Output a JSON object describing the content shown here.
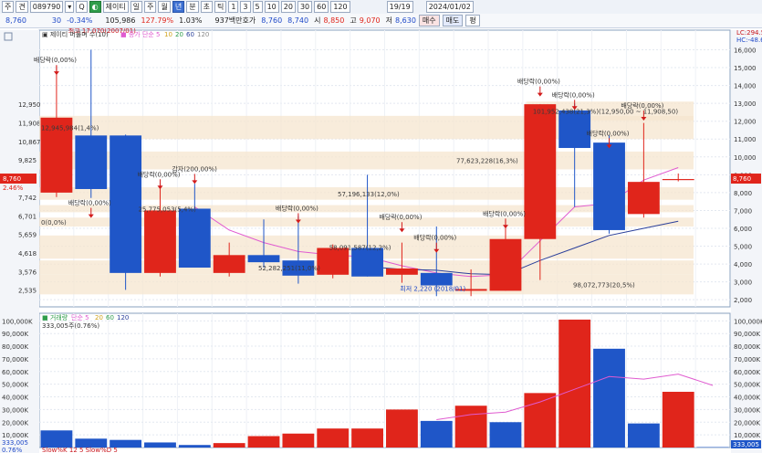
{
  "toolbar": {
    "buttons": [
      "주",
      "견",
      "089790",
      "▾",
      "Q",
      "◐",
      "제이티",
      "일",
      "주",
      "월",
      "년",
      "분",
      "초",
      "틱",
      "1",
      "3",
      "5",
      "10",
      "20",
      "30",
      "60",
      "120"
    ],
    "page": "19/19",
    "date": "2024/01/02"
  },
  "quote": {
    "price": "8,760",
    "change": "30",
    "rate": "-0.34%",
    "volume": "105,986",
    "volume_rate": "127.79%",
    "turnover": "1.03%",
    "amount_label": "937백만",
    "hoga_label": "호가",
    "ask": "8,760",
    "bid": "8,740",
    "open_label": "시",
    "open": "8,850",
    "high_label": "고",
    "high": "9,070",
    "low_label": "저",
    "low": "8,630",
    "buy_label": "매수",
    "sell_label": "매도",
    "eval_label": "평"
  },
  "legend": {
    "price_title": "제이티 머물며 수(10)",
    "ma_label": "종가 단순 5",
    "ma_periods": [
      "10",
      "20",
      "60",
      "120"
    ],
    "volume_title": "거래량",
    "vol_ma_label": "단순 5",
    "vol_ma_periods": [
      "20",
      "60",
      "120"
    ],
    "volume_value": "333,005주(0.76%)",
    "bottom_label": "Slow%K 12 5 Slow%D 5"
  },
  "corner_labels": [
    "LC:294.59",
    "HC:-48.68"
  ],
  "chart_data": [
    {
      "type": "candlestick",
      "y_ticks": [
        2000,
        3000,
        4000,
        5000,
        6000,
        7000,
        8000,
        9000,
        10000,
        11000,
        12000,
        13000,
        14000,
        15000,
        16000
      ],
      "y_tick_labels": [
        "2,000",
        "3,000",
        "4,000",
        "5,000",
        "6,000",
        "7,000",
        "8,000",
        "9,000",
        "10,000",
        "11,000",
        "12,000",
        "13,000",
        "14,000",
        "15,000",
        "16,000"
      ],
      "ylim": [
        1600,
        17100
      ],
      "left_levels": [
        "12,950",
        "11,908",
        "10,867",
        "9,825",
        "8,784",
        "7,742",
        "6,701",
        "5,659",
        "4,618",
        "3,576",
        "2,535"
      ],
      "left_level_values": [
        12950,
        11908,
        10867,
        9825,
        8784,
        7742,
        6701,
        5659,
        4618,
        3576,
        2535
      ],
      "current_price": "8,760",
      "current_rate": "2.46%",
      "current_value": 8760,
      "candles": [
        {
          "o": 8000,
          "h": 15100,
          "l": 7750,
          "c": 12200
        },
        {
          "o": 11200,
          "h": 16000,
          "l": 7700,
          "c": 8200
        },
        {
          "o": 11200,
          "h": 11250,
          "l": 2550,
          "c": 3500
        },
        {
          "o": 3500,
          "h": 8500,
          "l": 3300,
          "c": 7000
        },
        {
          "o": 7100,
          "h": 8500,
          "l": 3800,
          "c": 3800
        },
        {
          "o": 3500,
          "h": 5200,
          "l": 3300,
          "c": 4500
        },
        {
          "o": 4500,
          "h": 6500,
          "l": 3800,
          "c": 4100
        },
        {
          "o": 4200,
          "h": 6700,
          "l": 2900,
          "c": 3350
        },
        {
          "o": 3400,
          "h": 5100,
          "l": 3200,
          "c": 4900
        },
        {
          "o": 4900,
          "h": 9000,
          "l": 3300,
          "c": 3300
        },
        {
          "o": 3400,
          "h": 5200,
          "l": 2950,
          "c": 3750
        },
        {
          "o": 3500,
          "h": 6100,
          "l": 2200,
          "c": 2800
        },
        {
          "o": 2500,
          "h": 3700,
          "l": 2200,
          "c": 2600
        },
        {
          "o": 2500,
          "h": 6500,
          "l": 2500,
          "c": 5400
        },
        {
          "o": 5400,
          "h": 12950,
          "l": 3100,
          "c": 12950
        },
        {
          "o": 12600,
          "h": 13000,
          "l": 7200,
          "c": 10500
        },
        {
          "o": 10800,
          "h": 11200,
          "l": 5700,
          "c": 5900
        },
        {
          "o": 6800,
          "h": 11900,
          "l": 6600,
          "c": 8600
        },
        {
          "o": 8700,
          "h": 9070,
          "l": 8630,
          "c": 8760
        }
      ],
      "ma_line": [
        null,
        null,
        null,
        null,
        7200,
        5900,
        5200,
        4700,
        4500,
        4400,
        3900,
        3500,
        3300,
        3400,
        5300,
        7200,
        7400,
        8700,
        9400
      ],
      "long_ma_line": [
        null,
        null,
        null,
        null,
        null,
        null,
        null,
        null,
        null,
        3850,
        3700,
        3650,
        3450,
        3400,
        4200,
        4900,
        5600,
        6000,
        6400
      ],
      "bands": [
        {
          "label": "12,945,984(1,4%)",
          "from": 11000,
          "to": 12300
        },
        {
          "label": "77,623,228(16,3%)",
          "from": 9300,
          "to": 10300
        },
        {
          "label": "57,196,133(12,0%)",
          "from": 7600,
          "to": 8300
        },
        {
          "label": "25,775,053(5,4%)",
          "from": 6900,
          "to": 7300
        },
        {
          "label": "0(0,0%)",
          "from": 6100,
          "to": 6600
        },
        {
          "label": "58,091,587(12,2%)",
          "from": 4300,
          "to": 5600
        },
        {
          "label": "52,282,251(11,0%)",
          "from": 3400,
          "to": 4200
        },
        {
          "label": "98,072,773(20,5%)",
          "from": 2300,
          "to": 3400
        },
        {
          "label": "101,952,438(21,3%)(12,950,00 ~ 11,908,50)",
          "from": 12050,
          "to": 13100
        }
      ],
      "annotations": [
        {
          "text": "배당락(0,00%)",
          "i": 0,
          "v": 15300
        },
        {
          "text": "최고 17,070(2007/01)",
          "i": 1,
          "v": 16950
        },
        {
          "text": "배당락(0,00%)",
          "i": 1,
          "v": 7300
        },
        {
          "text": "배당락(0,00%)",
          "i": 3,
          "v": 8900
        },
        {
          "text": "감자(200,00%)",
          "i": 4,
          "v": 9200
        },
        {
          "text": "배당락(0,00%)",
          "i": 7,
          "v": 7000
        },
        {
          "text": "배당락(0,00%)",
          "i": 10,
          "v": 6500
        },
        {
          "text": "배당락(0,00%)",
          "i": 11,
          "v": 5350
        },
        {
          "text": "배당락(0,00%)",
          "i": 13,
          "v": 6700
        },
        {
          "text": "배당락(0,00%)",
          "i": 14,
          "v": 14100
        },
        {
          "text": "배당락(0,00%)",
          "i": 15,
          "v": 13350
        },
        {
          "text": "배당락(0,00%)",
          "i": 16,
          "v": 11200
        },
        {
          "text": "배당락(0,00%)",
          "i": 17,
          "v": 12750
        },
        {
          "text": "최저 2,220 (2018/01)",
          "i": 11,
          "v": 2500
        }
      ]
    },
    {
      "type": "bar",
      "title": "거래량",
      "y_ticks": [
        10000,
        20000,
        30000,
        40000,
        50000,
        60000,
        70000,
        80000,
        90000,
        100000
      ],
      "y_tick_labels": [
        "10,000K",
        "20,000K",
        "30,000K",
        "40,000K",
        "50,000K",
        "60,000K",
        "70,000K",
        "80,000K",
        "90,000K",
        "100,000K"
      ],
      "ylim": [
        0,
        106000
      ],
      "values": [
        13500,
        7000,
        6000,
        4000,
        2000,
        3500,
        9000,
        11000,
        15000,
        15000,
        30000,
        21000,
        33000,
        20000,
        43000,
        101000,
        78000,
        19000,
        44000,
        333
      ],
      "colors": [
        "blue",
        "blue",
        "blue",
        "blue",
        "blue",
        "red",
        "red",
        "red",
        "red",
        "red",
        "red",
        "blue",
        "red",
        "blue",
        "red",
        "red",
        "blue",
        "blue",
        "red",
        "blue"
      ],
      "ma_line": [
        null,
        null,
        null,
        null,
        null,
        null,
        null,
        null,
        null,
        null,
        null,
        22000,
        26000,
        28000,
        36000,
        46000,
        56000,
        54000,
        58000,
        49000
      ],
      "current_value": "333,005",
      "current_rate": "0.76%"
    }
  ]
}
